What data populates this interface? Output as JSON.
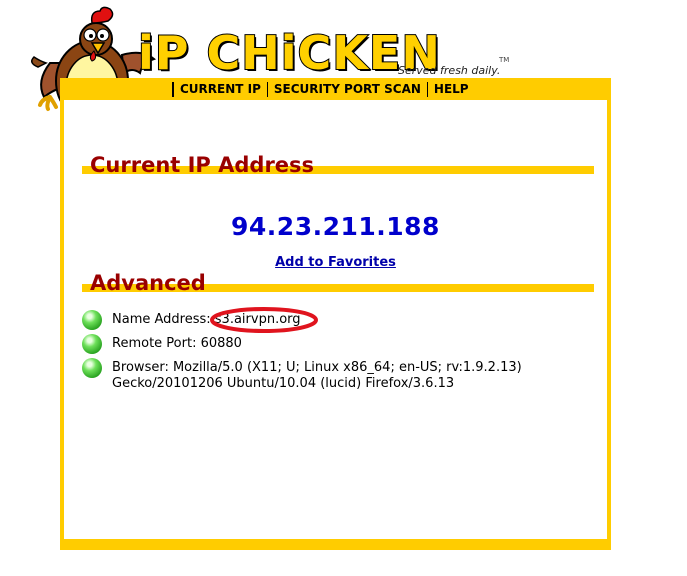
{
  "header": {
    "brand": "iP CHiCKEN",
    "tagline": "Served fresh daily.",
    "trademark": "TM",
    "mascot_icon": "chicken-mascot-icon"
  },
  "nav": [
    {
      "label": "CURRENT IP"
    },
    {
      "label": "SECURITY PORT SCAN"
    },
    {
      "label": "HELP"
    }
  ],
  "current_ip": {
    "heading": "Current IP Address",
    "ip": "94.23.211.188",
    "favorites_link": "Add to Favorites"
  },
  "advanced": {
    "heading": "Advanced",
    "name_label": "Name Address: ",
    "name_value": "s3.airvpn.org",
    "port_text": "Remote Port: 60880",
    "browser_line1": "Browser: Mozilla/5.0 (X11; U; Linux x86_64; en-US; rv:1.9.2.13)",
    "browser_line2": "Gecko/20101206 Ubuntu/10.04 (lucid) Firefox/3.6.13",
    "status_icon": "green-status-dot-icon"
  },
  "colors": {
    "frame": "#ffcc00",
    "heading": "#990000",
    "ip": "#0000cc",
    "annotation": "#e0141e"
  }
}
